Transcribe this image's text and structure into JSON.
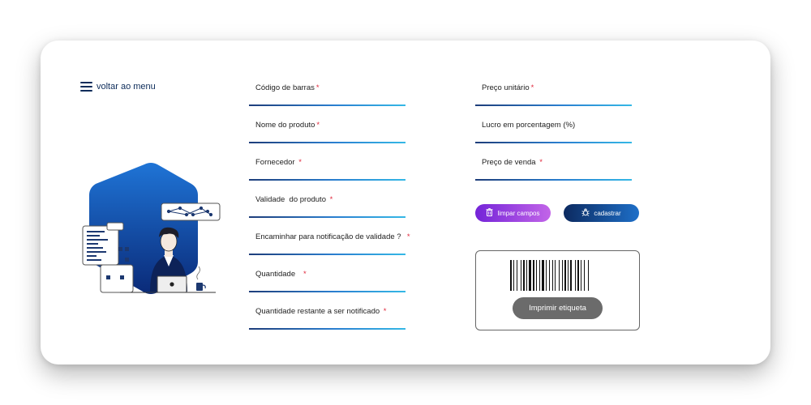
{
  "menu": {
    "label": "voltar ao menu"
  },
  "form_left": [
    {
      "label": "Código de barras",
      "required": "*"
    },
    {
      "label": "Nome do produto",
      "required": "*"
    },
    {
      "label": "Fornecedor",
      "required": "*"
    },
    {
      "label": "Validade  do produto",
      "required": "*"
    },
    {
      "label": "Encaminhar para notificação de validade ?",
      "required": "*"
    },
    {
      "label": "Quantidade",
      "required": "*"
    },
    {
      "label": "Quantidade restante a ser notificado",
      "required": "*"
    }
  ],
  "form_right": [
    {
      "label": "Preço unitário",
      "required": "*"
    },
    {
      "label": "Lucro em porcentagem (%)",
      "required": ""
    },
    {
      "label": "Preço de venda",
      "required": "*"
    }
  ],
  "buttons": {
    "clear": "limpar campos",
    "save": "cadastrar",
    "print": "Imprimir etiqueta"
  },
  "icons": {
    "menu": "hamburger-icon",
    "clear": "trash-icon",
    "save": "bug-icon"
  },
  "colors": {
    "navy": "#0d2c5a",
    "purple": "#7424d8",
    "blue": "#1e6fc8",
    "required": "#e0283c",
    "print_button": "#6b6b6b"
  }
}
